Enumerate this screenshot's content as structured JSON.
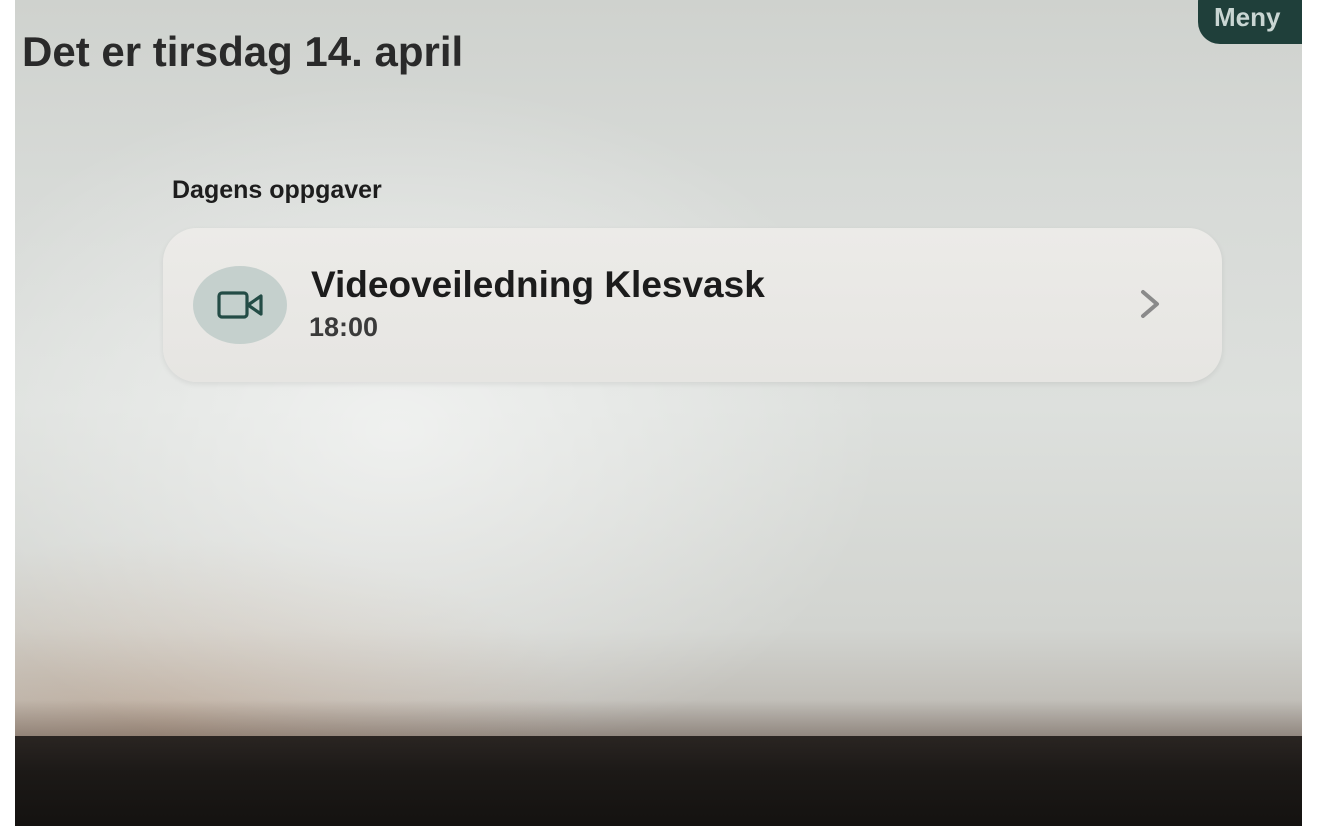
{
  "header": {
    "date_title": "Det er tirsdag 14. april",
    "menu_label": "Meny"
  },
  "tasks": {
    "section_title": "Dagens oppgaver",
    "items": [
      {
        "title": "Videoveiledning Klesvask",
        "time": "18:00",
        "icon": "video-camera-icon"
      }
    ]
  },
  "colors": {
    "accent": "#1f3f3a",
    "icon_bg": "#c5d0cd",
    "icon_stroke": "#244c46"
  }
}
